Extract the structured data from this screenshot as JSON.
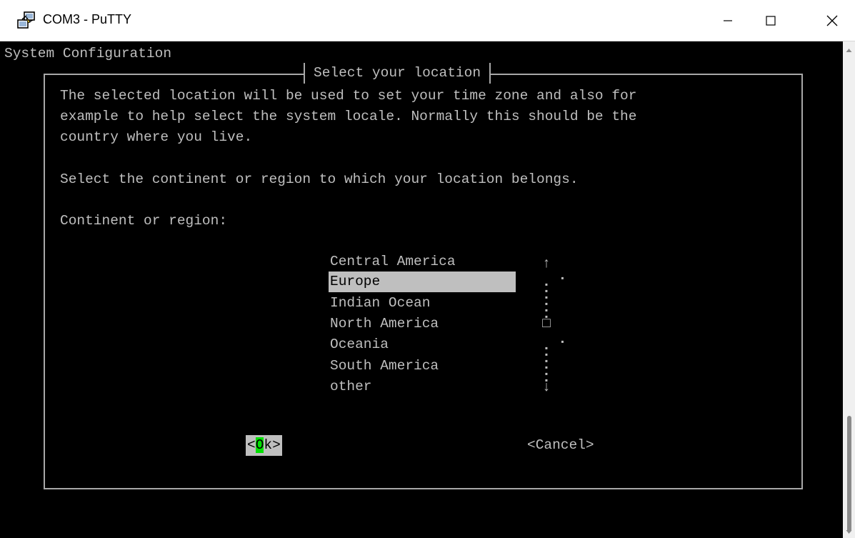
{
  "window": {
    "title": "COM3 - PuTTY",
    "minimize_label": "—",
    "maximize_label": "☐",
    "close_label": "✕"
  },
  "terminal": {
    "header": "System Configuration"
  },
  "dialog": {
    "title": "Select your location",
    "description_lines": [
      "The selected location will be used to set your time zone and also for",
      "example to help select the system locale. Normally this should be the",
      "country where you live."
    ],
    "prompt": "Select the continent or region to which your location belongs.",
    "list_label": "Continent or region:",
    "options": [
      "Central America",
      "Europe",
      "Indian Ocean",
      "North America",
      "Oceania",
      "South America",
      "other"
    ],
    "selected_option": "Europe",
    "ok_prefix": "<",
    "ok_hotkey": "O",
    "ok_suffix": "k>",
    "cancel_label": "<Cancel>"
  },
  "list_scroll": {
    "up_arrow": "↑",
    "down_arrow": "↓",
    "thumb": "□",
    "track": "▪"
  },
  "colors": {
    "terminal_bg": "#000000",
    "terminal_text": "#bfbfbf",
    "highlight_bg": "#bfbfbf",
    "hotkey_green": "#00e000"
  }
}
